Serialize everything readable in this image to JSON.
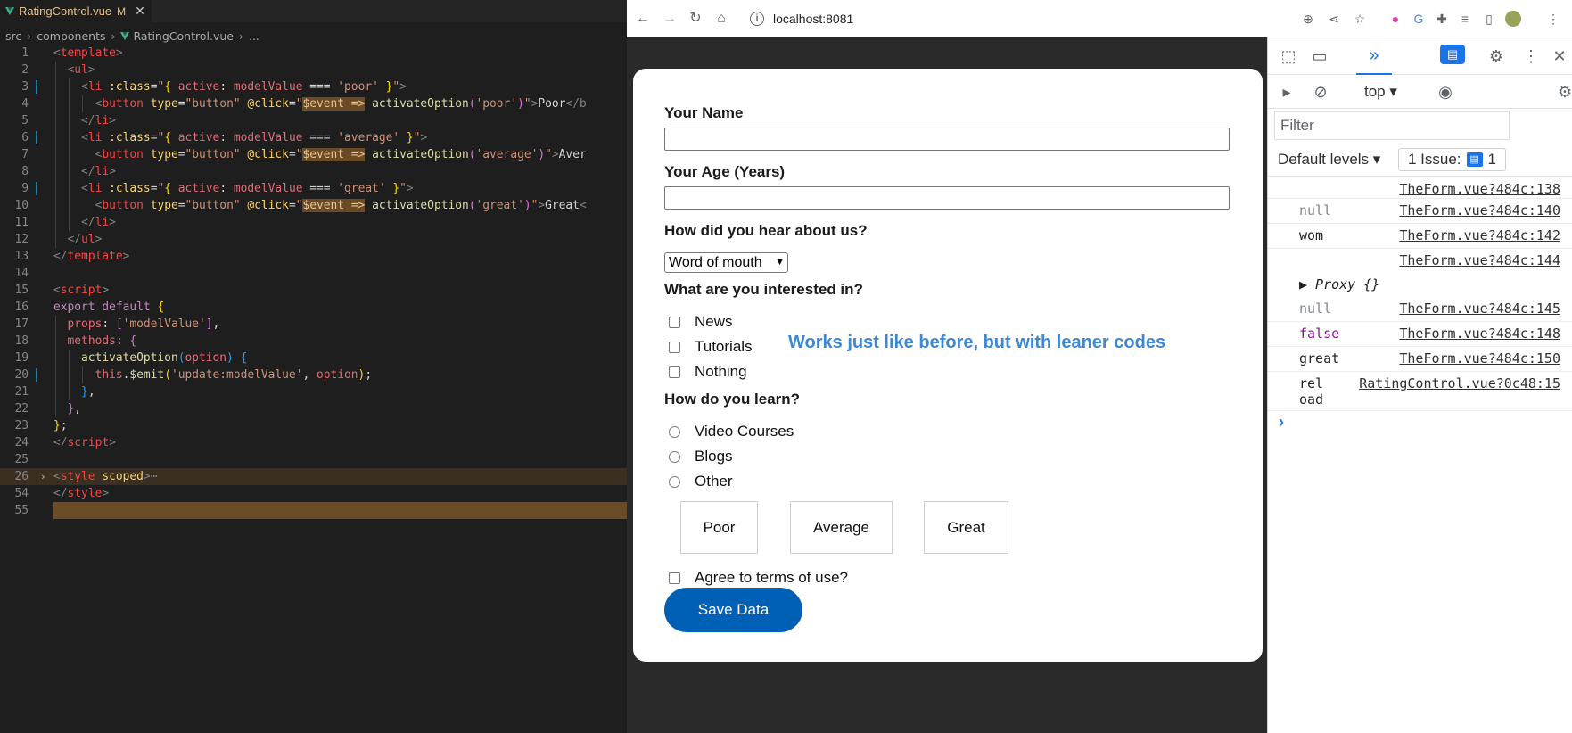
{
  "editor": {
    "tab": {
      "filename": "RatingControl.vue",
      "modified": "M",
      "close": "✕"
    },
    "breadcrumb": [
      "src",
      "components",
      "RatingControl.vue",
      "..."
    ],
    "lines": [
      {
        "n": "1",
        "html": "<span class='t-gr'>&lt;</span><span class='t-tag'>template</span><span class='t-gr'>&gt;</span>"
      },
      {
        "n": "2",
        "html": "  <span class='t-gr'>&lt;</span><span class='t-tag'>ul</span><span class='t-gr'>&gt;</span>"
      },
      {
        "n": "3",
        "html": "    <span class='t-gr'>&lt;</span><span class='t-tag'>li</span> <span class='t-at'>:class</span>=<span class='t-str'>\"</span><span class='t-y'>{</span> <span class='t-red'>active</span>: <span class='t-red'>modelValue</span> === <span class='t-str'>'poor'</span> <span class='t-y'>}</span><span class='t-str'>\"</span><span class='t-gr'>&gt;</span>"
      },
      {
        "n": "4",
        "html": "      <span class='t-gr'>&lt;</span><span class='t-tag'>button</span> <span class='t-at'>type</span>=<span class='t-str'>\"button\"</span> <span class='t-at'>@click</span>=<span class='t-str'>\"</span><span class='t-hl'>$event =&gt;</span> <span class='t-fn'>activateOption</span><span class='t-p'>(</span><span class='t-str'>'poor'</span><span class='t-p'>)</span><span class='t-str'>\"</span><span class='t-gr'>&gt;</span>Poor<span class='t-gr'>&lt;/b</span>"
      },
      {
        "n": "5",
        "html": "    <span class='t-gr'>&lt;/</span><span class='t-tag'>li</span><span class='t-gr'>&gt;</span>"
      },
      {
        "n": "6",
        "html": "    <span class='t-gr'>&lt;</span><span class='t-tag'>li</span> <span class='t-at'>:class</span>=<span class='t-str'>\"</span><span class='t-y'>{</span> <span class='t-red'>active</span>: <span class='t-red'>modelValue</span> === <span class='t-str'>'average'</span> <span class='t-y'>}</span><span class='t-str'>\"</span><span class='t-gr'>&gt;</span>"
      },
      {
        "n": "7",
        "html": "      <span class='t-gr'>&lt;</span><span class='t-tag'>button</span> <span class='t-at'>type</span>=<span class='t-str'>\"button\"</span> <span class='t-at'>@click</span>=<span class='t-str'>\"</span><span class='t-hl'>$event =&gt;</span> <span class='t-fn'>activateOption</span><span class='t-p'>(</span><span class='t-str'>'average'</span><span class='t-p'>)</span><span class='t-str'>\"</span><span class='t-gr'>&gt;</span>Aver"
      },
      {
        "n": "8",
        "html": "    <span class='t-gr'>&lt;/</span><span class='t-tag'>li</span><span class='t-gr'>&gt;</span>"
      },
      {
        "n": "9",
        "html": "    <span class='t-gr'>&lt;</span><span class='t-tag'>li</span> <span class='t-at'>:class</span>=<span class='t-str'>\"</span><span class='t-y'>{</span> <span class='t-red'>active</span>: <span class='t-red'>modelValue</span> === <span class='t-str'>'great'</span> <span class='t-y'>}</span><span class='t-str'>\"</span><span class='t-gr'>&gt;</span>"
      },
      {
        "n": "10",
        "html": "      <span class='t-gr'>&lt;</span><span class='t-tag'>button</span> <span class='t-at'>type</span>=<span class='t-str'>\"button\"</span> <span class='t-at'>@click</span>=<span class='t-str'>\"</span><span class='t-hl'>$event =&gt;</span> <span class='t-fn'>activateOption</span><span class='t-p'>(</span><span class='t-str'>'great'</span><span class='t-p'>)</span><span class='t-str'>\"</span><span class='t-gr'>&gt;</span>Great<span class='t-gr'>&lt;</span>"
      },
      {
        "n": "11",
        "html": "    <span class='t-gr'>&lt;/</span><span class='t-tag'>li</span><span class='t-gr'>&gt;</span>"
      },
      {
        "n": "12",
        "html": "  <span class='t-gr'>&lt;/</span><span class='t-tag'>ul</span><span class='t-gr'>&gt;</span>"
      },
      {
        "n": "13",
        "html": "<span class='t-gr'>&lt;/</span><span class='t-tag'>template</span><span class='t-gr'>&gt;</span>"
      },
      {
        "n": "14",
        "html": ""
      },
      {
        "n": "15",
        "html": "<span class='t-gr'>&lt;</span><span class='t-tag'>script</span><span class='t-gr'>&gt;</span>"
      },
      {
        "n": "16",
        "html": "<span class='t-kw'>export</span> <span class='t-kw'>default</span> <span class='t-y'>{</span>"
      },
      {
        "n": "17",
        "html": "  <span class='t-red'>props</span>: <span class='t-p'>[</span><span class='t-str'>'modelValue'</span><span class='t-p'>]</span>,"
      },
      {
        "n": "18",
        "html": "  <span class='t-red'>methods</span>: <span class='t-p'>{</span>"
      },
      {
        "n": "19",
        "html": "    <span class='t-fn'>activateOption</span><span class='t-b'>(</span><span class='t-red'>option</span><span class='t-b'>)</span> <span class='t-b'>{</span>"
      },
      {
        "n": "20",
        "html": "      <span class='t-red'>this</span>.<span class='t-fn'>$emit</span><span class='t-y'>(</span><span class='t-str'>'update:modelValue'</span>, <span class='t-red'>option</span><span class='t-y'>)</span>;"
      },
      {
        "n": "21",
        "html": "    <span class='t-b'>}</span>,"
      },
      {
        "n": "22",
        "html": "  <span class='t-p'>}</span>,"
      },
      {
        "n": "23",
        "html": "<span class='t-y'>}</span>;"
      },
      {
        "n": "24",
        "html": "<span class='t-gr'>&lt;/</span><span class='t-tag'>script</span><span class='t-gr'>&gt;</span>"
      },
      {
        "n": "25",
        "html": ""
      },
      {
        "n": "26",
        "html": "<span class='t-gr'>&lt;</span><span class='t-tag'>style</span> <span class='t-at'>scoped</span><span class='t-gr'>&gt;</span><span class='t-gr'>⋯</span>"
      },
      {
        "n": "54",
        "html": "<span class='t-gr'>&lt;/</span><span class='t-tag'>style</span><span class='t-gr'>&gt;</span>"
      },
      {
        "n": "55",
        "html": ""
      }
    ]
  },
  "browser": {
    "url": "localhost:8081",
    "page": {
      "name_label": "Your Name",
      "age_label": "Your Age (Years)",
      "referrer_label": "How did you hear about us?",
      "referrer_value": "Word of mouth",
      "interest_label": "What are you interested in?",
      "interests": [
        "News",
        "Tutorials",
        "Nothing"
      ],
      "annotation": "Works just like before, but with leaner codes",
      "learn_label": "How do you learn?",
      "learn_options": [
        "Video Courses",
        "Blogs",
        "Other"
      ],
      "rating_buttons": [
        "Poor",
        "Average",
        "Great"
      ],
      "terms_label": "Agree to terms of use?",
      "save_label": "Save Data"
    }
  },
  "devtools": {
    "context": "top",
    "filter_placeholder": "Filter",
    "levels": "Default levels",
    "issues": "1 Issue:",
    "issue_count": "1",
    "log": [
      {
        "value": "",
        "source": "TheForm.vue?484c:138"
      },
      {
        "value": "null",
        "source": "TheForm.vue?484c:140"
      },
      {
        "value": "wom",
        "source": "TheForm.vue?484c:142"
      },
      {
        "value": "",
        "source": "TheForm.vue?484c:144"
      },
      {
        "value": "▶ Proxy {}",
        "source": ""
      },
      {
        "value": "null",
        "source": "TheForm.vue?484c:145"
      },
      {
        "value": "false",
        "source": "TheForm.vue?484c:148"
      },
      {
        "value": "great",
        "source": "TheForm.vue?484c:150"
      },
      {
        "value": "rel\noad",
        "source": "RatingControl.vue?0c48:15"
      }
    ],
    "prompt": "›"
  }
}
